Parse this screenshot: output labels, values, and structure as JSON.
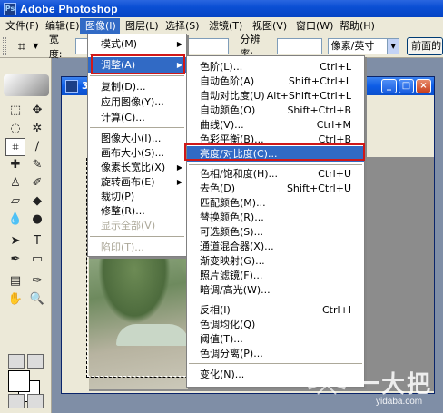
{
  "app": {
    "title": "Adobe Photoshop",
    "icon": "photoshop-app-icon"
  },
  "menubar": [
    {
      "label": "文件(F)"
    },
    {
      "label": "编辑(E)"
    },
    {
      "label": "图像(I)"
    },
    {
      "label": "图层(L)"
    },
    {
      "label": "选择(S)"
    },
    {
      "label": "滤镜(T)"
    },
    {
      "label": "视图(V)"
    },
    {
      "label": "窗口(W)"
    },
    {
      "label": "帮助(H)"
    }
  ],
  "options_bar": {
    "tool_icon": "crop-icon",
    "width_label": "宽度:",
    "resolution_label": "分辨率:",
    "unit_select": "像素/英寸",
    "front_image_button": "前面的图像"
  },
  "document": {
    "title_prefix": "3"
  },
  "image_menu": [
    {
      "label": "模式(M)",
      "submenu": true
    },
    {
      "label": "调整(A)",
      "submenu": true,
      "highlighted": true
    },
    {
      "label": "复制(D)..."
    },
    {
      "label": "应用图像(Y)..."
    },
    {
      "label": "计算(C)..."
    },
    {
      "label": "图像大小(I)..."
    },
    {
      "label": "画布大小(S)..."
    },
    {
      "label": "像素长宽比(X)",
      "submenu": true
    },
    {
      "label": "旋转画布(E)",
      "submenu": true
    },
    {
      "label": "裁切(P)"
    },
    {
      "label": "修整(R)..."
    },
    {
      "label": "显示全部(V)",
      "disabled": true
    },
    {
      "label": "陷印(T)...",
      "disabled": true
    }
  ],
  "adjust_menu": [
    {
      "label": "色阶(L)...",
      "shortcut": "Ctrl+L"
    },
    {
      "label": "自动色阶(A)",
      "shortcut": "Shift+Ctrl+L"
    },
    {
      "label": "自动对比度(U)",
      "shortcut": "Alt+Shift+Ctrl+L"
    },
    {
      "label": "自动颜色(O)",
      "shortcut": "Shift+Ctrl+B"
    },
    {
      "label": "曲线(V)...",
      "shortcut": "Ctrl+M"
    },
    {
      "label": "色彩平衡(B)...",
      "shortcut": "Ctrl+B"
    },
    {
      "label": "亮度/对比度(C)...",
      "shortcut": "",
      "highlighted": true
    },
    {
      "label": "色相/饱和度(H)...",
      "shortcut": "Ctrl+U"
    },
    {
      "label": "去色(D)",
      "shortcut": "Shift+Ctrl+U"
    },
    {
      "label": "匹配颜色(M)...",
      "shortcut": ""
    },
    {
      "label": "替换颜色(R)...",
      "shortcut": ""
    },
    {
      "label": "可选颜色(S)...",
      "shortcut": ""
    },
    {
      "label": "通道混合器(X)...",
      "shortcut": ""
    },
    {
      "label": "渐变映射(G)...",
      "shortcut": ""
    },
    {
      "label": "照片滤镜(F)...",
      "shortcut": ""
    },
    {
      "label": "暗调/高光(W)...",
      "shortcut": ""
    },
    {
      "label": "反相(I)",
      "shortcut": "Ctrl+I"
    },
    {
      "label": "色调均化(Q)",
      "shortcut": ""
    },
    {
      "label": "阈值(T)...",
      "shortcut": ""
    },
    {
      "label": "色调分离(P)...",
      "shortcut": ""
    },
    {
      "label": "变化(N)...",
      "shortcut": ""
    }
  ],
  "watermark": {
    "text": "一大把",
    "url": "yidaba.com"
  }
}
